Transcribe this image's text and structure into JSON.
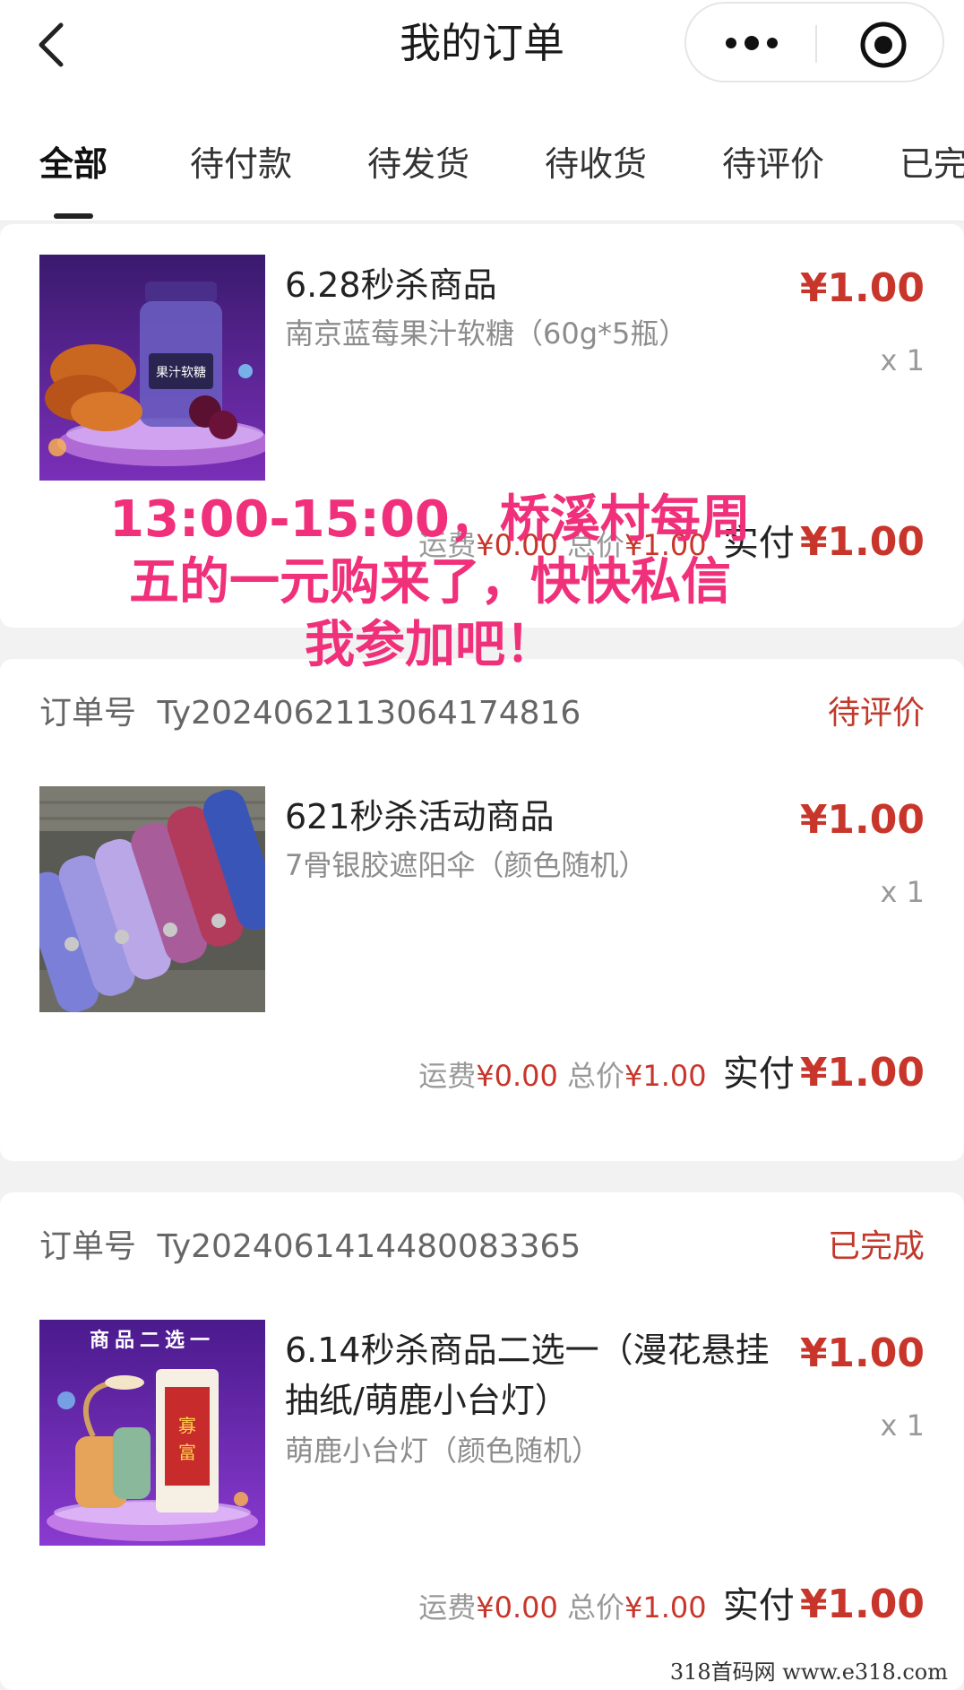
{
  "header": {
    "title": "我的订单"
  },
  "tabs": [
    "全部",
    "待付款",
    "待发货",
    "待收货",
    "待评价",
    "已完"
  ],
  "orders": [
    {
      "order_label": "",
      "status": "",
      "product_title": "6.28秒杀商品",
      "product_spec": "南京蓝莓果汁软糖（60g*5瓶）",
      "price": "¥1.00",
      "qty": "x 1",
      "summary": {
        "shipping_label": "运费",
        "shipping": "¥0.00",
        "total_label": "总价",
        "total": "¥1.00",
        "pay_label": "实付",
        "pay": "¥1.00"
      },
      "image_text": "果汁软糖"
    },
    {
      "order_label": "订单号",
      "order_no": "Ty2024062113064174816",
      "status": "待评价",
      "product_title": "621秒杀活动商品",
      "product_spec": "7骨银胶遮阳伞（颜色随机）",
      "price": "¥1.00",
      "qty": "x 1",
      "summary": {
        "shipping_label": "运费",
        "shipping": "¥0.00",
        "total_label": "总价",
        "total": "¥1.00",
        "pay_label": "实付",
        "pay": "¥1.00"
      }
    },
    {
      "order_label": "订单号",
      "order_no": "Ty2024061414480083365",
      "status": "已完成",
      "product_title": "6.14秒杀商品二选一（漫花悬挂抽纸/萌鹿小台灯）",
      "product_spec": "萌鹿小台灯（颜色随机）",
      "price": "¥1.00",
      "qty": "x 1",
      "summary": {
        "shipping_label": "运费",
        "shipping": "¥0.00",
        "total_label": "总价",
        "total": "¥1.00",
        "pay_label": "实付",
        "pay": "¥1.00"
      },
      "image_text": "商品二选一"
    }
  ],
  "overlay": {
    "lines": [
      "13:00-15:00，桥溪村每周",
      "五的一元购来了，快快私信",
      "我参加吧！"
    ]
  },
  "watermark": "318首码网  www.e318.com",
  "colors": {
    "price_red": "#c8362b",
    "status_red": "#c0392b",
    "overlay_pink": "#f0307a",
    "page_bg": "#f2f2f2"
  },
  "icons": [
    "back-arrow-icon",
    "more-dots-icon",
    "close-target-icon"
  ]
}
